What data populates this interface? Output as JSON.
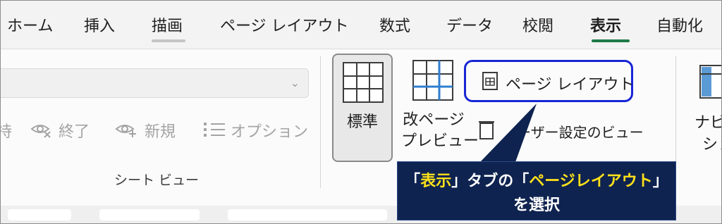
{
  "tabs": [
    {
      "label": "ホーム",
      "active": false
    },
    {
      "label": "挿入",
      "active": false
    },
    {
      "label": "描画",
      "active": false
    },
    {
      "label": "ページ レイアウト",
      "active": false
    },
    {
      "label": "数式",
      "active": false
    },
    {
      "label": "データ",
      "active": false
    },
    {
      "label": "校閲",
      "active": false
    },
    {
      "label": "表示",
      "active": true
    },
    {
      "label": "自動化",
      "active": false
    }
  ],
  "sheet_view": {
    "group_label": "シート ビュー",
    "cut_char": "持",
    "end_label": "終了",
    "new_label": "新規",
    "options_label": "オプション"
  },
  "workbook_views": {
    "normal_label": "標準",
    "page_break_line1": "改ページ",
    "page_break_line2": "プレビュー",
    "page_layout_label": "ページ レイアウト",
    "custom_views_label": "ーザー設定のビュー"
  },
  "right_partial": {
    "line1": "ナビ",
    "line2": "ショ"
  },
  "callout": {
    "q_open": "「",
    "hl1": "表示",
    "q_close": "」",
    "mid": "タブの",
    "hl2": "ページレイアウト",
    "line2": "を選択"
  },
  "colors": {
    "active_tab_underline": "#1e7a46",
    "draw_tab_underline": "#c4c4c4",
    "highlight_border": "#1826d6",
    "callout_bg": "#0e2350",
    "callout_highlight_text": "#ffe11a"
  }
}
